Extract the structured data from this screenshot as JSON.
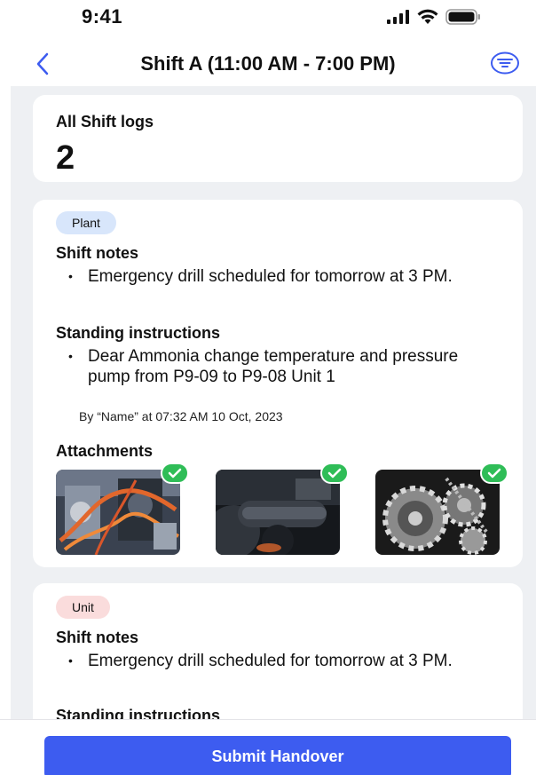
{
  "status_bar": {
    "time": "9:41"
  },
  "nav": {
    "title": "Shift A (11:00 AM - 7:00 PM)"
  },
  "summary": {
    "label": "All Shift logs",
    "count": "2"
  },
  "logs": [
    {
      "badge": "Plant",
      "shift_notes_title": "Shift notes",
      "shift_notes": [
        "Emergency drill scheduled for tomorrow at 3 PM."
      ],
      "standing_title": "Standing instructions",
      "standing": [
        "Dear Ammonia change temperature and pressure pump from P9-09 to P9-08 Unit 1"
      ],
      "byline": "By “Name” at 07:32 AM 10 Oct, 2023",
      "attachments_title": "Attachments"
    },
    {
      "badge": "Unit",
      "shift_notes_title": "Shift notes",
      "shift_notes": [
        "Emergency drill scheduled for tomorrow at 3 PM."
      ],
      "standing_title": "Standing instructions"
    }
  ],
  "footer": {
    "submit_label": "Submit Handover"
  },
  "colors": {
    "accent": "#3d5cf0",
    "success": "#2fbd57",
    "plant_badge": "#d8e6fb",
    "unit_badge": "#fadcdc"
  }
}
